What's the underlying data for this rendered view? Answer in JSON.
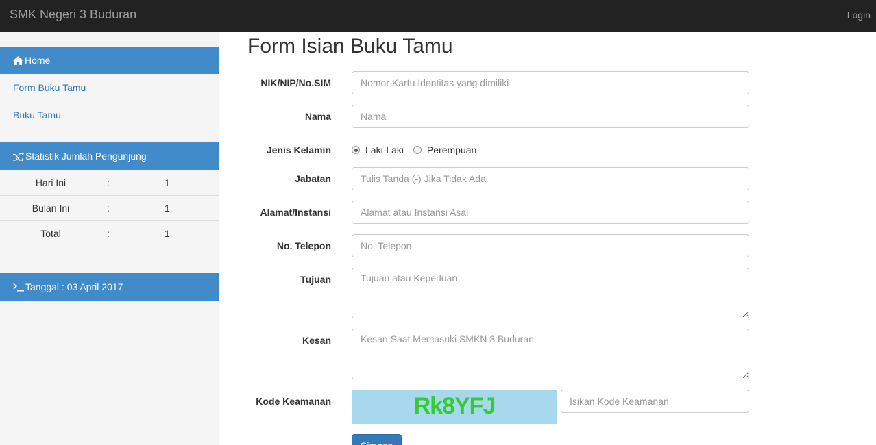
{
  "navbar": {
    "brand": "SMK Negeri 3 Buduran",
    "login": "Login"
  },
  "sidebar": {
    "home": "Home",
    "links": [
      "Form Buku Tamu",
      "Buku Tamu"
    ],
    "stats_title": "Statistik Jumlah Pengunjung",
    "stats": [
      {
        "label": "Hari Ini",
        "sep": ":",
        "value": "1"
      },
      {
        "label": "Bulan Ini",
        "sep": ":",
        "value": "1"
      },
      {
        "label": "Total",
        "sep": ":",
        "value": "1"
      }
    ],
    "date_label": "Tanggal : 03 April 2017"
  },
  "form": {
    "title": "Form Isian Buku Tamu",
    "fields": {
      "nik": {
        "label": "NIK/NIP/No.SIM",
        "placeholder": "Nomor Kartu Identitas yang dimiliki",
        "value": ""
      },
      "nama": {
        "label": "Nama",
        "placeholder": "Nama",
        "value": ""
      },
      "gender": {
        "label": "Jenis Kelamin",
        "options": [
          "Laki-Laki",
          "Perempuan"
        ],
        "selected": "Laki-Laki"
      },
      "jabatan": {
        "label": "Jabatan",
        "placeholder": "Tulis Tanda (-) Jika Tidak Ada",
        "value": ""
      },
      "alamat": {
        "label": "Alamat/Instansi",
        "placeholder": "Alamat atau Instansi Asal",
        "value": ""
      },
      "telepon": {
        "label": "No. Telepon",
        "placeholder": "No. Telepon",
        "value": ""
      },
      "tujuan": {
        "label": "Tujuan",
        "placeholder": "Tujuan atau Keperluan",
        "value": ""
      },
      "kesan": {
        "label": "Kesan",
        "placeholder": "Kesan Saat Memasuki SMKN 3 Buduran",
        "value": ""
      },
      "kode": {
        "label": "Kode Keamanan",
        "captcha_text": "Rk8YFJ",
        "placeholder": "Isikan Kode Keamanan",
        "value": ""
      }
    },
    "submit_label": "Simpan"
  },
  "colors": {
    "navbar": "#222222",
    "sidebar_header": "#428bca",
    "link": "#337ab7",
    "captcha_bg": "#a8d8ee",
    "captcha_text": "#33cc33"
  },
  "icons": {
    "home": "home-icon",
    "stats": "shuffle-icon",
    "date": "terminal-icon"
  }
}
